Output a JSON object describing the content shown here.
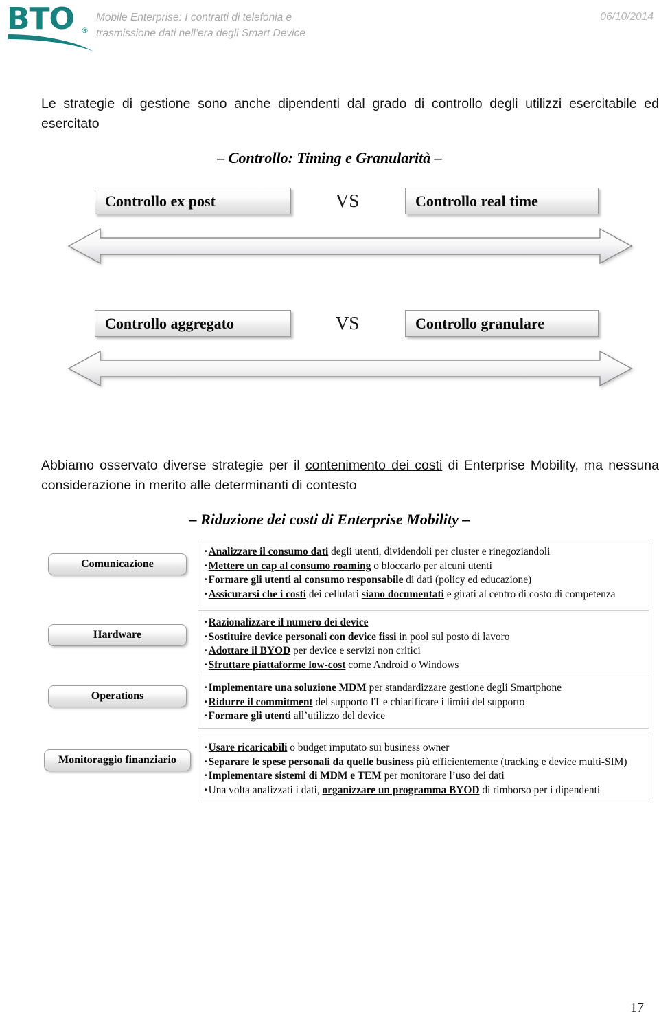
{
  "header": {
    "logo_text": "BTO",
    "logo_registered": "®",
    "title_line1": "Mobile Enterprise: I contratti di telefonia e",
    "title_line2": "trasmissione dati nell’era degli Smart Device",
    "date": "06/10/2014",
    "brand_color": "#17817f",
    "title_color": "#aaaaaa"
  },
  "main": {
    "lead_paragraph": {
      "part1": "Le ",
      "underline1": "strategie di gestione",
      "part2": " sono anche ",
      "underline2": "dipendenti dal grado di controllo",
      "part3": " degli utilizzi esercitabile ed esercitato"
    },
    "heading_1": "– Controllo: Timing e Granularità –",
    "vs_label": "VS",
    "comparisons": [
      {
        "left": "Controllo ex post",
        "right": "Controllo real time"
      },
      {
        "left": "Controllo aggregato",
        "right": "Controllo granulare"
      }
    ],
    "mid_paragraph": {
      "part1": "Abbiamo osservato diverse strategie per il ",
      "underline1": "contenimento dei costi",
      "part2": " di Enterprise Mobility, ma nessuna considerazione in merito alle determinanti di contesto"
    },
    "heading_2": "– Riduzione dei costi di Enterprise Mobility –",
    "categories": [
      {
        "label": "Comunicazione",
        "items": [
          {
            "bold": "Analizzare il consumo dati",
            "rest": " degli utenti, dividendoli per cluster e rinegoziandoli"
          },
          {
            "bold": "Mettere un cap al consumo roaming",
            "rest": " o bloccarlo per alcuni utenti"
          },
          {
            "bold": "Formare gli utenti al consumo responsabile",
            "rest": " di dati (policy ed educazione)"
          },
          {
            "bold": "Assicurarsi che i costi",
            "rest": " dei cellulari ",
            "bold2": "siano documentati",
            "rest2": " e girati al centro di costo di competenza"
          }
        ]
      },
      {
        "label": "Hardware",
        "items": [
          {
            "bold": "Razionalizzare il numero dei device",
            "rest": ""
          },
          {
            "bold": "Sostituire device personali con device fissi",
            "rest": " in pool sul posto di lavoro"
          },
          {
            "bold": "Adottare il BYOD",
            "rest": " per device e servizi non critici"
          },
          {
            "bold": "Sfruttare piattaforme low-cost",
            "rest": " come Android o Windows"
          }
        ]
      },
      {
        "label": "Operations",
        "items": [
          {
            "bold": "Implementare una soluzione MDM",
            "rest": " per standardizzare gestione degli Smartphone"
          },
          {
            "bold": "Ridurre il commitment",
            "rest": " del supporto IT e chiarificare i limiti del supporto"
          },
          {
            "bold": "Formare gli utenti",
            "rest": " all’utilizzo del device"
          }
        ]
      },
      {
        "label": "Monitoraggio finanziario",
        "items": [
          {
            "bold": "Usare ricaricabili",
            "rest": " o budget imputato sui business owner"
          },
          {
            "bold": "Separare le spese personali da quelle business",
            "rest": " più efficientemente (tracking e device multi-SIM)"
          },
          {
            "bold": "Implementare sistemi di MDM e TEM",
            "rest": " per monitorare l’uso dei dati"
          },
          {
            "bold": "",
            "rest": "Una volta analizzati i dati, ",
            "bold2": "organizzare un programma BYOD",
            "rest2": " di rimborso per i dipendenti"
          }
        ]
      }
    ]
  },
  "footer": {
    "page_number": "17"
  }
}
